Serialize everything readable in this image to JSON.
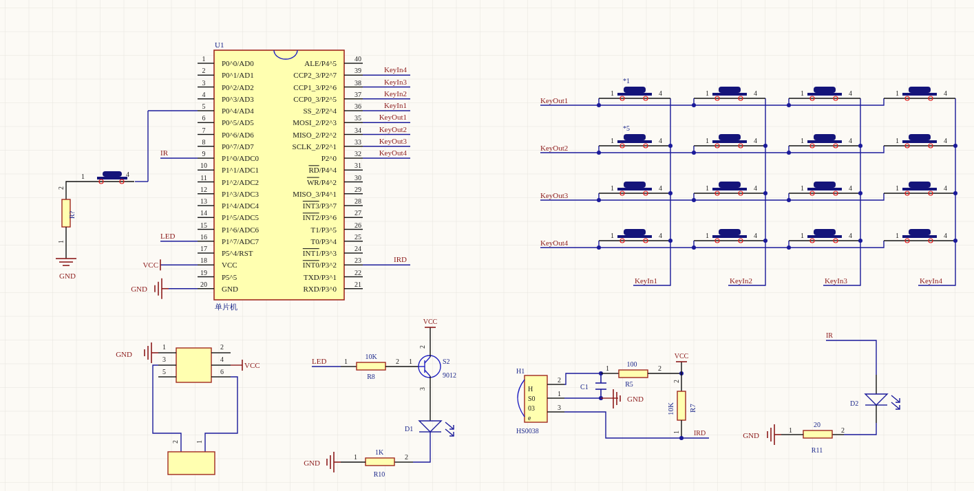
{
  "mcu": {
    "designator": "U1",
    "part_name": "单片机",
    "left_pins": [
      {
        "number": "1",
        "name": "P0^0/AD0",
        "kind": "none"
      },
      {
        "number": "2",
        "name": "P0^1/AD1",
        "kind": "none"
      },
      {
        "number": "3",
        "name": "P0^2/AD2",
        "kind": "none"
      },
      {
        "number": "4",
        "name": "P0^3/AD3",
        "kind": "none"
      },
      {
        "number": "5",
        "name": "P0^4/AD4",
        "kind": "button"
      },
      {
        "number": "6",
        "name": "P0^5/AD5",
        "kind": "none"
      },
      {
        "number": "7",
        "name": "P0^6/AD6",
        "kind": "none"
      },
      {
        "number": "8",
        "name": "P0^7/AD7",
        "kind": "none"
      },
      {
        "number": "9",
        "name": "P1^0/ADC0",
        "kind": "signal",
        "net": "IR"
      },
      {
        "number": "10",
        "name": "P1^1/ADC1",
        "kind": "none"
      },
      {
        "number": "11",
        "name": "P1^2/ADC2",
        "kind": "none"
      },
      {
        "number": "12",
        "name": "P1^3/ADC3",
        "kind": "none"
      },
      {
        "number": "13",
        "name": "P1^4/ADC4",
        "kind": "none"
      },
      {
        "number": "14",
        "name": "P1^5/ADC5",
        "kind": "none"
      },
      {
        "number": "15",
        "name": "P1^6/ADC6",
        "kind": "none"
      },
      {
        "number": "16",
        "name": "P1^7/ADC7",
        "kind": "signal",
        "net": "LED"
      },
      {
        "number": "17",
        "name": "P5^4/RST",
        "kind": "none"
      },
      {
        "number": "18",
        "name": "VCC",
        "kind": "power",
        "net": "VCC"
      },
      {
        "number": "19",
        "name": "P5^5",
        "kind": "none"
      },
      {
        "number": "20",
        "name": "GND",
        "kind": "ground",
        "net": "GND"
      }
    ],
    "right_pins": [
      {
        "number": "40",
        "name": "ALE/P4^5",
        "overbar": false
      },
      {
        "number": "39",
        "name": "CCP2_3/P2^7",
        "overbar": false,
        "net": "KeyIn4"
      },
      {
        "number": "38",
        "name": "CCP1_3/P2^6",
        "overbar": false,
        "net": "KeyIn3"
      },
      {
        "number": "37",
        "name": "CCP0_3/P2^5",
        "overbar": false,
        "net": "KeyIn2"
      },
      {
        "number": "36",
        "name": "SS_2/P2^4",
        "overbar": false,
        "net": "KeyIn1"
      },
      {
        "number": "35",
        "name": "MOSI_2/P2^3",
        "overbar": false,
        "net": "KeyOut1"
      },
      {
        "number": "34",
        "name": "MISO_2/P2^2",
        "overbar": false,
        "net": "KeyOut2"
      },
      {
        "number": "33",
        "name": "SCLK_2/P2^1",
        "overbar": false,
        "net": "KeyOut3"
      },
      {
        "number": "32",
        "name": "P2^0",
        "overbar": false,
        "net": "KeyOut4"
      },
      {
        "number": "31",
        "name": "RD/P4^4",
        "overbar": true
      },
      {
        "number": "30",
        "name": "WR/P4^2",
        "overbar": true
      },
      {
        "number": "29",
        "name": "MISO_3/P4^1",
        "overbar": false
      },
      {
        "number": "28",
        "name": "INT3/P3^7",
        "overbar": true
      },
      {
        "number": "27",
        "name": "INT2/P3^6",
        "overbar": true
      },
      {
        "number": "26",
        "name": "T1/P3^5",
        "overbar": false
      },
      {
        "number": "25",
        "name": "T0/P3^4",
        "overbar": false
      },
      {
        "number": "24",
        "name": "INT1/P3^3",
        "overbar": true
      },
      {
        "number": "23",
        "name": "INT0/P3^2",
        "overbar": true,
        "net": "IRD"
      },
      {
        "number": "22",
        "name": "TXD/P3^1",
        "overbar": false
      },
      {
        "number": "21",
        "name": "RXD/P3^0",
        "overbar": false
      }
    ]
  },
  "reset_button": {
    "pins": [
      "1",
      "4"
    ]
  },
  "pull_resistor": {
    "designator": "R?",
    "pins": [
      "2",
      "1"
    ],
    "ground": "GND"
  },
  "keypad": {
    "rows": [
      "KeyOut1",
      "KeyOut2",
      "KeyOut3",
      "KeyOut4"
    ],
    "columns": [
      "KeyIn1",
      "KeyIn2",
      "KeyIn3",
      "KeyIn4"
    ],
    "keys": [
      {
        "designator": "*1",
        "pins": [
          "1",
          "4"
        ]
      },
      {
        "pins": [
          "1",
          "4"
        ]
      },
      {
        "pins": [
          "1",
          "4"
        ]
      },
      {
        "pins": [
          "1",
          "4"
        ]
      },
      {
        "designator": "*5",
        "pins": [
          "1",
          "4"
        ]
      },
      {
        "pins": [
          "1",
          "4"
        ]
      },
      {
        "pins": [
          "1",
          "4"
        ]
      },
      {
        "pins": [
          "1",
          "4"
        ]
      },
      {
        "pins": [
          "1",
          "4"
        ]
      },
      {
        "pins": [
          "1",
          "4"
        ]
      },
      {
        "pins": [
          "1",
          "4"
        ]
      },
      {
        "pins": [
          "1",
          "4"
        ]
      },
      {
        "pins": [
          "1",
          "4"
        ]
      },
      {
        "pins": [
          "1",
          "4"
        ]
      },
      {
        "pins": [
          "1",
          "4"
        ]
      },
      {
        "pins": [
          "1",
          "4"
        ]
      }
    ]
  },
  "module": {
    "ground": "GND",
    "power": "VCC",
    "pins": [
      "1",
      "2",
      "3",
      "4",
      "5",
      "6"
    ],
    "connector_pins": [
      "2",
      "1"
    ]
  },
  "led_driver": {
    "input": "LED",
    "r8": {
      "designator": "R8",
      "value": "10K",
      "pins": [
        "1",
        "2"
      ]
    },
    "transistor": {
      "designator": "S2",
      "value": "9012",
      "pins": [
        "1",
        "2",
        "3"
      ]
    },
    "power": "VCC",
    "led": {
      "designator": "D1"
    },
    "r10": {
      "designator": "R10",
      "value": "1K",
      "pins": [
        "1",
        "2"
      ]
    },
    "ground": "GND"
  },
  "ir_receiver": {
    "designator": "H1",
    "body_labels": [
      "H",
      "S0",
      "03",
      "e"
    ],
    "part_name": "HS0038",
    "pins": [
      "2",
      "1",
      "3"
    ],
    "capacitor": {
      "designator": "C1"
    },
    "r5": {
      "designator": "R5",
      "value": "100",
      "pins": [
        "1",
        "2"
      ]
    },
    "power": "VCC",
    "r7": {
      "designator": "R7",
      "value": "10K",
      "pins": [
        "2",
        "1"
      ]
    },
    "ground": "GND",
    "output": "IRD"
  },
  "ir_emitter": {
    "input": "IR",
    "led": {
      "designator": "D2"
    },
    "r11": {
      "designator": "R11",
      "value": "20",
      "pins": [
        "1",
        "2"
      ]
    },
    "ground": "GND"
  }
}
